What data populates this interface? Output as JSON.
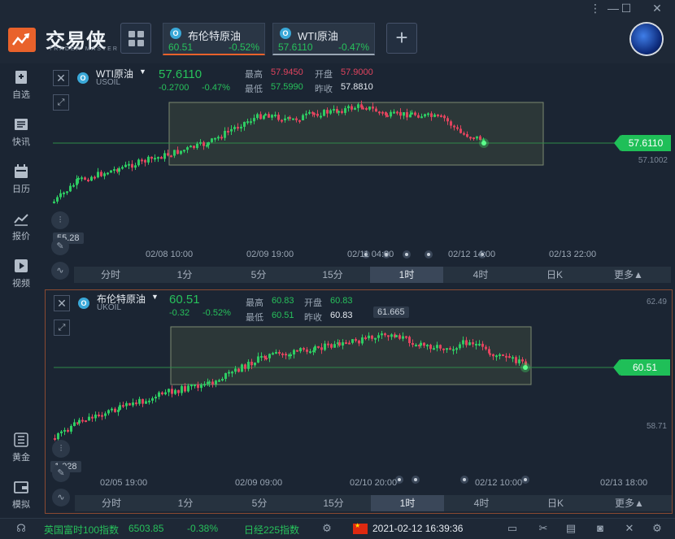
{
  "app": {
    "brand": "交易侠",
    "brand_sub": "TRADER MASTER",
    "window_controls": [
      "⋮",
      "—",
      "☐",
      "✕"
    ]
  },
  "quote_tabs": [
    {
      "name": "布伦特原油",
      "price": "60.51",
      "change_pct": "-0.52%"
    },
    {
      "name": "WTI原油",
      "price": "57.6110",
      "change_pct": "-0.47%"
    }
  ],
  "sidebar": {
    "items": [
      {
        "label": "自选",
        "icon": "bookmark-icon"
      },
      {
        "label": "快讯",
        "icon": "news-icon"
      },
      {
        "label": "日历",
        "icon": "calendar-icon"
      },
      {
        "label": "报价",
        "icon": "chart-line-icon"
      },
      {
        "label": "视频",
        "icon": "play-icon"
      },
      {
        "label": "黄金",
        "icon": "gold-icon"
      },
      {
        "label": "模拟",
        "icon": "wallet-icon"
      }
    ]
  },
  "panels": [
    {
      "name": "WTI原油",
      "code": "USOIL",
      "last": "57.6110",
      "change": "-0.2700",
      "change_pct": "-0.47%",
      "stats": {
        "high_label": "最高",
        "high": "57.9450",
        "open_label": "开盘",
        "open": "57.9000",
        "low_label": "最低",
        "low": "57.5990",
        "prev_label": "昨收",
        "prev": "57.8810"
      },
      "price_tag": "57.6110",
      "axis_right": [
        "57.1002"
      ],
      "axis_left_label": "55.28",
      "x_labels": [
        "02/08 10:00",
        "02/09 19:00",
        "02/11 04:00",
        "02/12 14:00",
        "02/13 22:00"
      ],
      "timeframes": [
        "分时",
        "1分",
        "5分",
        "15分",
        "1时",
        "4时",
        "日K",
        "更多▲"
      ],
      "active_timeframe": "1时"
    },
    {
      "name": "布伦特原油",
      "code": "UKOIL",
      "last": "60.51",
      "change": "-0.32",
      "change_pct": "-0.52%",
      "stats": {
        "high_label": "最高",
        "high": "60.83",
        "open_label": "开盘",
        "open": "60.83",
        "low_label": "最低",
        "low": "60.51",
        "prev_label": "昨收",
        "prev": "60.83"
      },
      "price_tag": "60.51",
      "max_label": "61.665",
      "axis_right": [
        "62.49",
        "58.71"
      ],
      "axis_left_label": "1.028",
      "x_labels": [
        "02/05 19:00",
        "02/09 09:00",
        "02/10 20:00",
        "02/12 10:00",
        "02/13 18:00"
      ],
      "timeframes": [
        "分时",
        "1分",
        "5分",
        "15分",
        "1时",
        "4时",
        "日K",
        "更多▲"
      ],
      "active_timeframe": "1时"
    }
  ],
  "ticker": {
    "index1_name": "英国富时100指数",
    "index1_value": "6503.85",
    "index1_change": "-0.38%",
    "index2_name": "日经225指数",
    "datetime": "2021-02-12 16:39:36"
  },
  "colors": {
    "up": "#27c15b",
    "down": "#e0445e",
    "accent": "#e9622b",
    "bg": "#1b2533"
  }
}
